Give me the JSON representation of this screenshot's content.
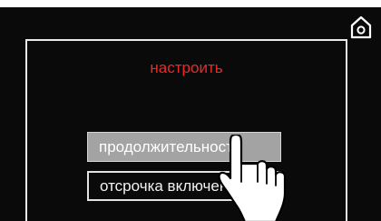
{
  "header": {
    "home_icon": "home-icon"
  },
  "menu": {
    "title": "настроить",
    "title_color": "#ea2a2a",
    "items": [
      {
        "label": "продолжительность",
        "selected": true
      },
      {
        "label": "отсрочка включения",
        "selected": false
      }
    ]
  },
  "overlay": {
    "pointer_icon": "hand-pointer-icon"
  }
}
